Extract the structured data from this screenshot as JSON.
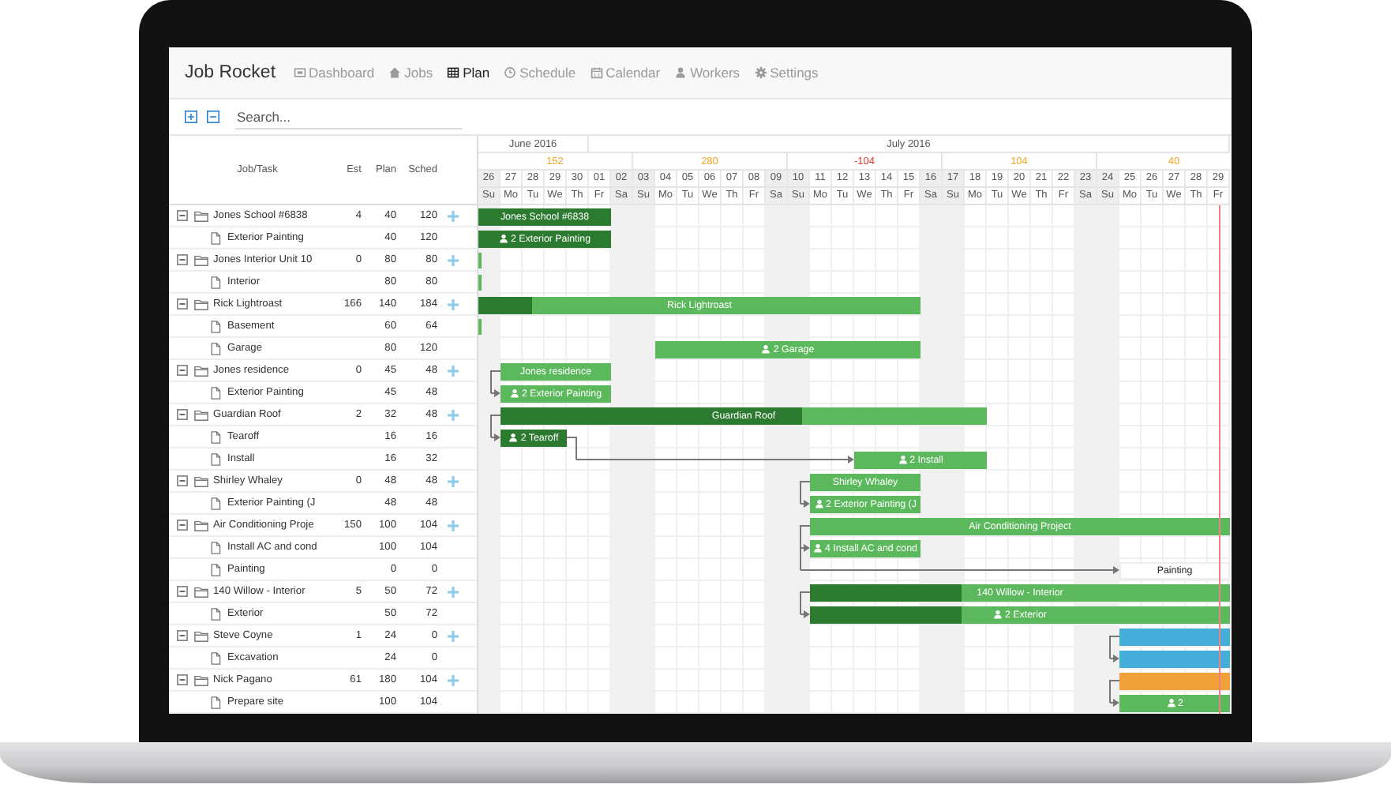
{
  "nav": {
    "brand": "Job Rocket",
    "items": [
      {
        "label": "Dashboard",
        "selected": false
      },
      {
        "label": "Jobs",
        "selected": false
      },
      {
        "label": "Plan",
        "selected": true
      },
      {
        "label": "Schedule",
        "selected": false
      },
      {
        "label": "Calendar",
        "selected": false
      },
      {
        "label": "Workers",
        "selected": false
      },
      {
        "label": "Settings",
        "selected": false
      }
    ]
  },
  "search": {
    "placeholder": "Search..."
  },
  "columns": [
    "Job/Task",
    "Est",
    "Plan",
    "Sched"
  ],
  "timeline": {
    "months": [
      {
        "label": "June 2016",
        "days": [
          {
            "date": "26",
            "weekday": "Su",
            "weekend": true,
            "today": false
          },
          {
            "date": "27",
            "weekday": "Mo",
            "weekend": false,
            "today": false
          },
          {
            "date": "28",
            "weekday": "Tu",
            "weekend": false,
            "today": false
          },
          {
            "date": "29",
            "weekday": "We",
            "weekend": false,
            "today": false
          },
          {
            "date": "30",
            "weekday": "Th",
            "weekend": false,
            "today": false
          }
        ]
      },
      {
        "label": "July 2016",
        "days": [
          {
            "date": "01",
            "weekday": "Fr",
            "weekend": false,
            "today": false
          },
          {
            "date": "02",
            "weekday": "Sa",
            "weekend": true,
            "today": false
          },
          {
            "date": "03",
            "weekday": "Su",
            "weekend": true,
            "today": false
          },
          {
            "date": "04",
            "weekday": "Mo",
            "weekend": false,
            "today": false
          },
          {
            "date": "05",
            "weekday": "Tu",
            "weekend": false,
            "today": false
          },
          {
            "date": "06",
            "weekday": "We",
            "weekend": false,
            "today": false
          },
          {
            "date": "07",
            "weekday": "Th",
            "weekend": false,
            "today": false
          },
          {
            "date": "08",
            "weekday": "Fr",
            "weekend": false,
            "today": false
          },
          {
            "date": "09",
            "weekday": "Sa",
            "weekend": true,
            "today": false
          },
          {
            "date": "10",
            "weekday": "Su",
            "weekend": true,
            "today": false
          },
          {
            "date": "11",
            "weekday": "Mo",
            "weekend": false,
            "today": false
          },
          {
            "date": "12",
            "weekday": "Tu",
            "weekend": false,
            "today": false
          },
          {
            "date": "13",
            "weekday": "We",
            "weekend": false,
            "today": false
          },
          {
            "date": "14",
            "weekday": "Th",
            "weekend": false,
            "today": false
          },
          {
            "date": "15",
            "weekday": "Fr",
            "weekend": false,
            "today": false
          },
          {
            "date": "16",
            "weekday": "Sa",
            "weekend": true,
            "today": false
          },
          {
            "date": "17",
            "weekday": "Su",
            "weekend": true,
            "today": false
          },
          {
            "date": "18",
            "weekday": "Mo",
            "weekend": false,
            "today": false
          },
          {
            "date": "19",
            "weekday": "Tu",
            "weekend": false,
            "today": false
          },
          {
            "date": "20",
            "weekday": "We",
            "weekend": false,
            "today": false
          },
          {
            "date": "21",
            "weekday": "Th",
            "weekend": false,
            "today": false
          },
          {
            "date": "22",
            "weekday": "Fr",
            "weekend": false,
            "today": false
          },
          {
            "date": "23",
            "weekday": "Sa",
            "weekend": true,
            "today": false
          },
          {
            "date": "24",
            "weekday": "Su",
            "weekend": true,
            "today": false
          },
          {
            "date": "25",
            "weekday": "Mo",
            "weekend": false,
            "today": false
          },
          {
            "date": "26",
            "weekday": "Tu",
            "weekend": false,
            "today": false
          },
          {
            "date": "27",
            "weekday": "We",
            "weekend": false,
            "today": false
          },
          {
            "date": "28",
            "weekday": "Th",
            "weekend": false,
            "today": false
          },
          {
            "date": "29",
            "weekday": "Fr",
            "weekend": false,
            "today": true
          }
        ]
      }
    ],
    "weeks": [
      {
        "total": "152",
        "color": "#f5a623"
      },
      {
        "total": "280",
        "color": "#f5a623"
      },
      {
        "total": "-104",
        "color": "#e53935"
      },
      {
        "total": "104",
        "color": "#f5a623"
      },
      {
        "total": "40",
        "color": "#f5a623"
      }
    ]
  },
  "jobs": [
    {
      "name": "Jones School #6838",
      "est": "4",
      "plan": "40",
      "sched": "120",
      "expanded": true,
      "bar": {
        "kind": "bar",
        "label": "Jones School #6838",
        "color": "#2b7a2f"
      },
      "tasks": [
        {
          "name": "Exterior Painting",
          "plan": "40",
          "sched": "120",
          "bar": {
            "kind": "bar",
            "workers": "2",
            "label": "Exterior Painting",
            "color": "#2b7a2f",
            "depends_on_parent": false,
            "depends_on_previous": false
          }
        }
      ]
    },
    {
      "name": "Jones Interior Unit 10",
      "est": "0",
      "plan": "80",
      "sched": "80",
      "expanded": true,
      "bar": {
        "kind": "marker",
        "color": "#5cb85c"
      },
      "tasks": [
        {
          "name": "Interior",
          "plan": "80",
          "sched": "80",
          "bar": {
            "kind": "marker",
            "color": "#5cb85c",
            "depends_on_parent": false,
            "depends_on_previous": false
          }
        }
      ]
    },
    {
      "name": "Rick Lightroast",
      "est": "166",
      "plan": "140",
      "sched": "184",
      "expanded": true,
      "bar": {
        "kind": "bar",
        "label": "Rick Lightroast",
        "color": "#5cb85c",
        "level": 0.12
      },
      "tasks": [
        {
          "name": "Basement",
          "plan": "60",
          "sched": "64",
          "bar": {
            "kind": "marker",
            "color": "#5cb85c",
            "depends_on_parent": false,
            "depends_on_previous": false
          }
        },
        {
          "name": "Garage",
          "plan": "80",
          "sched": "120",
          "bar": {
            "kind": "bar",
            "workers": "2",
            "label": "Garage",
            "color": "#5cb85c",
            "depends_on_parent": false,
            "depends_on_previous": false
          }
        }
      ]
    },
    {
      "name": "Jones residence",
      "est": "0",
      "plan": "45",
      "sched": "48",
      "expanded": true,
      "bar": {
        "kind": "bar",
        "label": "Jones residence",
        "color": "#5cb85c"
      },
      "tasks": [
        {
          "name": "Exterior Painting",
          "plan": "45",
          "sched": "48",
          "bar": {
            "kind": "bar",
            "workers": "2",
            "label": "Exterior Painting",
            "color": "#5cb85c",
            "depends_on_parent": true,
            "depends_on_previous": false
          }
        }
      ]
    },
    {
      "name": "Guardian Roof",
      "est": "2",
      "plan": "32",
      "sched": "48",
      "expanded": true,
      "bar": {
        "kind": "bar",
        "label": "Guardian Roof",
        "color": "#5cb85c",
        "level": 0.62
      },
      "tasks": [
        {
          "name": "Tearoff",
          "plan": "16",
          "sched": "16",
          "bar": {
            "kind": "bar",
            "workers": "2",
            "label": "Tearoff",
            "color": "#2b7a2f",
            "depends_on_parent": true,
            "depends_on_previous": false
          }
        },
        {
          "name": "Install",
          "plan": "16",
          "sched": "32",
          "bar": {
            "kind": "bar",
            "workers": "2",
            "label": "Install",
            "color": "#5cb85c",
            "depends_on_parent": false,
            "depends_on_previous": true
          }
        }
      ]
    },
    {
      "name": "Shirley Whaley",
      "est": "0",
      "plan": "48",
      "sched": "48",
      "expanded": true,
      "bar": {
        "kind": "bar",
        "label": "Shirley Whaley",
        "color": "#5cb85c"
      },
      "tasks": [
        {
          "name": "Exterior Painting (J",
          "plan": "48",
          "sched": "48",
          "bar": {
            "kind": "bar",
            "workers": "2",
            "label": "Exterior Painting (J",
            "color": "#5cb85c",
            "depends_on_parent": true,
            "depends_on_previous": false
          }
        }
      ]
    },
    {
      "name": "Air Conditioning Proje",
      "est": "150",
      "plan": "100",
      "sched": "104",
      "expanded": true,
      "bar": {
        "kind": "bar",
        "label": "Air Conditioning Project",
        "color": "#5cb85c"
      },
      "tasks": [
        {
          "name": "Install AC and cond",
          "plan": "100",
          "sched": "104",
          "bar": {
            "kind": "bar",
            "workers": "4",
            "label": "Install AC and cond",
            "color": "#5cb85c",
            "depends_on_parent": true,
            "depends_on_previous": false
          }
        },
        {
          "name": "Painting",
          "plan": "0",
          "sched": "0",
          "bar": {
            "kind": "unscheduled",
            "label": "Painting",
            "color": "#ffffff",
            "depends_on_parent": true,
            "depends_on_previous": false
          }
        }
      ]
    },
    {
      "name": "140 Willow - Interior",
      "est": "5",
      "plan": "50",
      "sched": "72",
      "expanded": true,
      "bar": {
        "kind": "bar",
        "label": "140 Willow - Interior",
        "color": "#5cb85c",
        "level": 0.36
      },
      "tasks": [
        {
          "name": "Exterior",
          "plan": "50",
          "sched": "72",
          "bar": {
            "kind": "bar",
            "workers": "2",
            "label": "Exterior",
            "color": "#5cb85c",
            "level": 0.36,
            "depends_on_parent": true,
            "depends_on_previous": false
          }
        }
      ]
    },
    {
      "name": "Steve Coyne",
      "est": "1",
      "plan": "24",
      "sched": "0",
      "expanded": true,
      "bar": {
        "kind": "bar",
        "color": "#45aed8"
      },
      "tasks": [
        {
          "name": "Excavation",
          "plan": "24",
          "sched": "0",
          "bar": {
            "kind": "bar",
            "color": "#45aed8",
            "depends_on_parent": true,
            "depends_on_previous": false
          }
        }
      ]
    },
    {
      "name": "Nick Pagano",
      "est": "61",
      "plan": "180",
      "sched": "104",
      "expanded": true,
      "bar": {
        "kind": "bar",
        "color": "#f0a13a"
      },
      "tasks": [
        {
          "name": "Prepare site",
          "plan": "100",
          "sched": "104",
          "bar": {
            "kind": "bar",
            "workers": "2",
            "color": "#5cb85c",
            "depends_on_parent": true,
            "depends_on_previous": false
          }
        }
      ]
    }
  ]
}
